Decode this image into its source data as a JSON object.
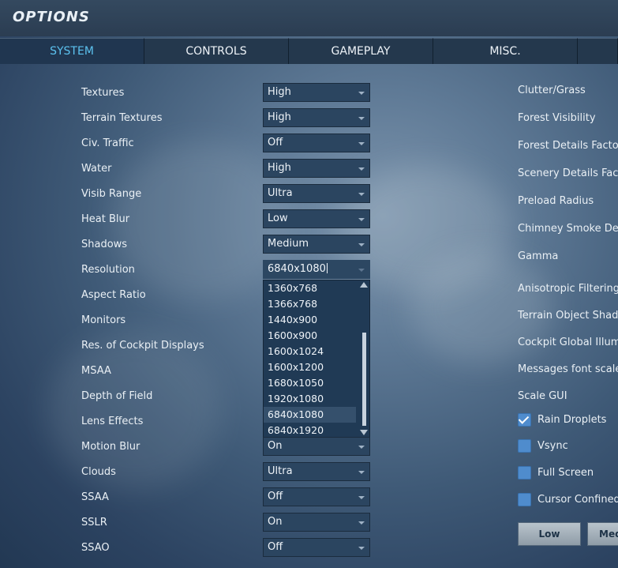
{
  "title": "OPTIONS",
  "tabs": [
    {
      "label": "SYSTEM"
    },
    {
      "label": "CONTROLS"
    },
    {
      "label": "GAMEPLAY"
    },
    {
      "label": "MISC."
    }
  ],
  "left_settings": [
    {
      "label": "Textures",
      "value": "High"
    },
    {
      "label": "Terrain Textures",
      "value": "High"
    },
    {
      "label": "Civ. Traffic",
      "value": "Off"
    },
    {
      "label": "Water",
      "value": "High"
    },
    {
      "label": "Visib Range",
      "value": "Ultra"
    },
    {
      "label": "Heat Blur",
      "value": "Low"
    },
    {
      "label": "Shadows",
      "value": "Medium"
    },
    {
      "label": "Resolution",
      "value": "6840x1080"
    },
    {
      "label": "Aspect Ratio"
    },
    {
      "label": "Monitors"
    },
    {
      "label": "Res. of Cockpit Displays"
    },
    {
      "label": "MSAA"
    },
    {
      "label": "Depth of Field"
    },
    {
      "label": "Lens Effects"
    },
    {
      "label": "Motion Blur",
      "value": "On"
    },
    {
      "label": "Clouds",
      "value": "Ultra"
    },
    {
      "label": "SSAA",
      "value": "Off"
    },
    {
      "label": "SSLR",
      "value": "On"
    },
    {
      "label": "SSAO",
      "value": "Off"
    }
  ],
  "resolution_options": [
    "1360x768",
    "1366x768",
    "1440x900",
    "1600x900",
    "1600x1024",
    "1600x1200",
    "1680x1050",
    "1920x1080",
    "6840x1080",
    "6840x1920"
  ],
  "highlighted_option": "6840x1080",
  "right_settings": [
    {
      "label": "Clutter/Grass"
    },
    {
      "label": "Forest Visibility"
    },
    {
      "label": "Forest Details Factor"
    },
    {
      "label": "Scenery Details Factor"
    },
    {
      "label": "Preload Radius"
    },
    {
      "label": "Chimney Smoke Density"
    },
    {
      "label": "Gamma"
    },
    {
      "label": "Anisotropic Filtering"
    },
    {
      "label": "Terrain Object Shadows"
    },
    {
      "label": "Cockpit Global Illumination"
    },
    {
      "label": "Messages font scale"
    },
    {
      "label": "Scale GUI"
    }
  ],
  "checkboxes": [
    {
      "label": "Rain Droplets",
      "checked": true
    },
    {
      "label": "Vsync",
      "checked": false
    },
    {
      "label": "Full Screen",
      "checked": false
    },
    {
      "label": "Cursor Confined to Game Window",
      "checked": false
    }
  ],
  "preset_buttons": [
    {
      "label": "Low"
    },
    {
      "label": "Medium"
    }
  ],
  "colors": {
    "active_tab_text": "#5cc2ef",
    "checkbox": "#4f8ccd"
  }
}
